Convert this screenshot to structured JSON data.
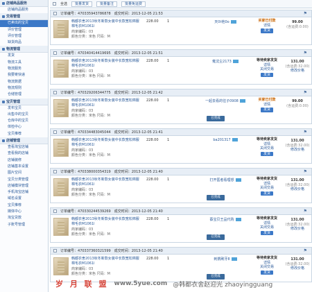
{
  "sidebar": [
    {
      "head": "店铺商品服务",
      "items": [
        "店铺商品服务"
      ]
    },
    {
      "head": "交易管理",
      "items": [
        "已卖出的宝贝",
        "评价管理",
        "评价管理",
        "缺货商品"
      ]
    },
    {
      "head": "物流管理",
      "items": [
        "发货",
        "物流工具",
        "物流服务",
        "我要寄快递",
        "物流数据",
        "物流规则",
        "仓储管理"
      ]
    },
    {
      "head": "宝贝管理",
      "items": [
        "发布宝贝",
        "出售中的宝贝",
        "仓库中的宝贝",
        "体检中心",
        "宝贝推荐"
      ]
    },
    {
      "head": "店铺管理",
      "items": [
        "查看淘宝店铺",
        "查看我的店铺",
        "店铺装修",
        "店铺基本设置",
        "图片空间",
        "宝贝分类管理",
        "店铺模块管理",
        "手机淘宝店铺",
        "域名设置",
        "宝贝推荐",
        "媒体中心",
        "淘宝贷款",
        "子账号管理"
      ]
    }
  ],
  "toolbar": {
    "select_all": "全选",
    "batch_ship": "批量发货",
    "batch_remark": "批量备注",
    "batch_free": "批量免运费"
  },
  "labels": {
    "order_no": "订单编号：",
    "deal_time": "成交时间："
  },
  "orders": [
    {
      "no": "470335943786878",
      "time": "2013-12-05 21:53",
      "title": "韩都衣舍2013秋冬新款女装中长款宽松棉服 棉毛衣M1061l",
      "seller": "商家编码：03",
      "attrs": "颜色分类：米色   尺码：M",
      "price": "228.00",
      "qty": "1",
      "buyer": "天0t他0o",
      "stamp": "",
      "status": "买家已付款",
      "status2": "详情",
      "btn": "发货",
      "total": "99.00",
      "ship": "(含运费:0.00)"
    },
    {
      "no": "470340414419695",
      "time": "2013-12-05 21:51",
      "title": "韩都衣舍2013秋冬新款女装中长款宽松棉服 棉毛衣M1061l",
      "seller": "商家编码：03",
      "attrs": "颜色分类：米色   尺码：M",
      "price": "228.00",
      "qty": "1",
      "buyer": "雍沈尘2173",
      "stamp": "",
      "status": "等待卖家发货",
      "status2": "详情",
      "status3": "关闭交易",
      "btn": "发货",
      "total": "131.00",
      "ship": "(含运费:32.00)",
      "total2": "修改价格"
    },
    {
      "no": "470329206344775",
      "time": "2013-12-05 21:42",
      "title": "韩都衣舍2013秋冬新款女装中长款宽松棉服 棉毛衣M1061l",
      "seller": "商家编码：03",
      "attrs": "颜色分类：米色   尺码：M",
      "price": "228.00",
      "qty": "1",
      "buyer": "一起去看的往子0908",
      "stamp": "已完成",
      "status": "买家已付款",
      "status2": "详情",
      "btn": "发货",
      "total": "99.00",
      "ship": "(含运费:0.00)"
    },
    {
      "no": "470334483045044",
      "time": "2013-12-05 21:41",
      "title": "韩都衣舍2013秋冬新款女装中长款宽松棉服 棉毛衣M1061l",
      "seller": "商家编码：03",
      "attrs": "颜色分类：米色   尺码：M",
      "price": "228.00",
      "qty": "1",
      "buyer": "ba201317",
      "stamp": "",
      "status": "等待卖家发货",
      "status2": "详情",
      "status3": "关闭交易",
      "btn": "发货",
      "total": "131.00",
      "ship": "(含运费:32.00)",
      "total2": "修改价格"
    },
    {
      "no": "470338000354319",
      "time": "2013-12-05 21:40",
      "title": "韩都衣舍2013秋冬新款女装中长款宽松棉服 棉毛衣M1061l",
      "seller": "商家编码：03",
      "attrs": "颜色分类：米色   尺码：M",
      "price": "228.00",
      "qty": "1",
      "buyer": "打开医者看理想",
      "stamp": "已完成",
      "status": "等待卖家发货",
      "status2": "详情",
      "status3": "关闭交易",
      "btn": "发货",
      "total": "131.00",
      "ship": "(含运费:32.00)",
      "total2": "修改价格"
    },
    {
      "no": "470330244539269",
      "time": "2013-12-05 21:40",
      "title": "韩都衣舍2013秋冬新款女装中长款宽松棉服 棉毛衣M1061l",
      "seller": "商家编码：03",
      "attrs": "颜色分类：米色   尺码：M",
      "price": "228.00",
      "qty": "1",
      "buyer": "蔡宝贝王品代购",
      "stamp": "已完成",
      "status": "等待卖家发货",
      "status2": "详情",
      "status3": "关闭交易",
      "btn": "发货",
      "total": "131.00",
      "ship": "(含运费:32.00)",
      "total2": "修改价格"
    },
    {
      "no": "470337360321599",
      "time": "2013-12-05 21:40",
      "title": "韩都衣舍2013秋冬新款女装中长款宽松棉服 棉毛衣M1061l",
      "seller": "商家编码：03",
      "attrs": "颜色分类：米色   尺码：M",
      "price": "228.00",
      "qty": "1",
      "buyer": "刺猬刷牙8",
      "stamp": "已完成",
      "status": "等待卖家发货",
      "status2": "详情",
      "status3": "关闭交易",
      "btn": "发货",
      "total": "131.00",
      "ship": "(含运费:32.00)",
      "total2": "修改价格"
    }
  ],
  "watermark": {
    "a": "岁 月 联 盟",
    "b": "www.5yue.com",
    "c": "@韩都衣舍赵迎光 zhaoyingguang"
  }
}
